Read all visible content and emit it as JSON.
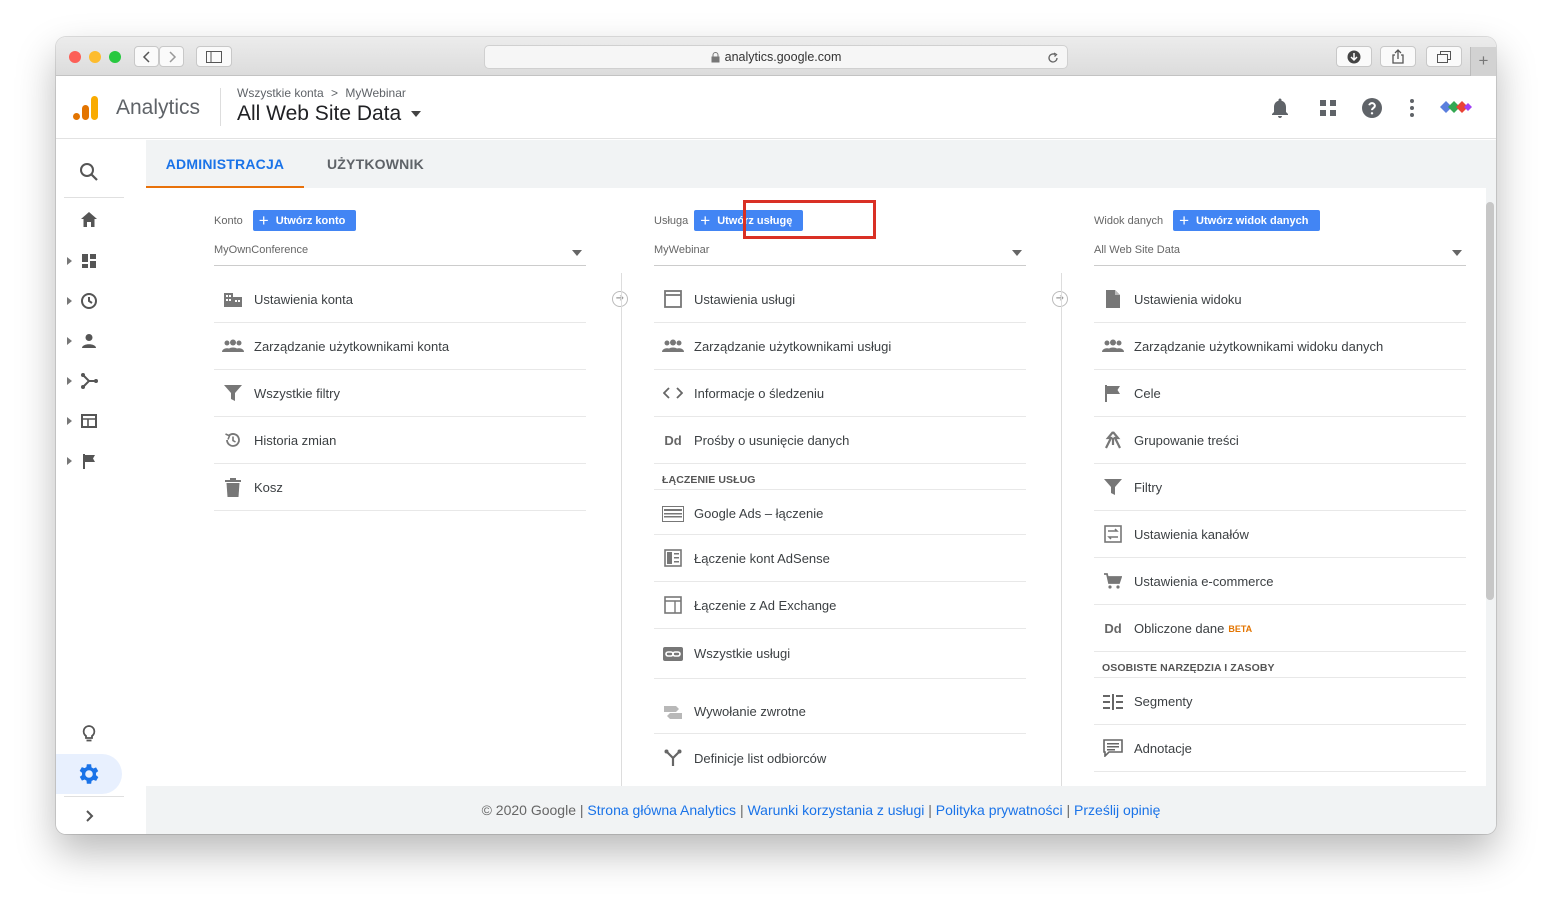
{
  "browser": {
    "url": "analytics.google.com"
  },
  "header": {
    "brand": "Analytics",
    "breadcrumb_account": "Wszystkie konta",
    "breadcrumb_sep": ">",
    "breadcrumb_property": "MyWebinar",
    "view_name": "All Web Site Data"
  },
  "tabs": {
    "admin": "ADMINISTRACJA",
    "user": "UŻYTKOWNIK"
  },
  "account_col": {
    "label": "Konto",
    "create_button": "Utwórz konto",
    "selected": "MyOwnConference",
    "items": [
      {
        "label": "Ustawienia konta",
        "icon": "building-icon"
      },
      {
        "label": "Zarządzanie użytkownikami konta",
        "icon": "people-icon"
      },
      {
        "label": "Wszystkie filtry",
        "icon": "filter-icon"
      },
      {
        "label": "Historia zmian",
        "icon": "history-icon"
      },
      {
        "label": "Kosz",
        "icon": "trash-icon"
      }
    ]
  },
  "property_col": {
    "label": "Usługa",
    "create_button": "Utwórz usługę",
    "selected": "MyWebinar",
    "items": [
      {
        "label": "Ustawienia usługi",
        "icon": "window-icon"
      },
      {
        "label": "Zarządzanie użytkownikami usługi",
        "icon": "people-icon"
      },
      {
        "label": "Informacje o śledzeniu",
        "icon": "code-icon"
      },
      {
        "label": "Prośby o usunięcie danych",
        "icon": "dd-icon"
      }
    ],
    "section_label": "ŁĄCZENIE USŁUG",
    "linking_items": [
      {
        "label": "Google Ads – łączenie",
        "icon": "ads-icon"
      },
      {
        "label": "Łączenie kont AdSense",
        "icon": "adsense-icon"
      },
      {
        "label": "Łączenie z Ad Exchange",
        "icon": "adexchange-icon"
      },
      {
        "label": "Wszystkie usługi",
        "icon": "link-icon"
      },
      {
        "label": "Wywołanie zwrotne",
        "icon": "postback-icon"
      },
      {
        "label": "Definicje list odbiorców",
        "icon": "audience-icon"
      }
    ]
  },
  "view_col": {
    "label": "Widok danych",
    "create_button": "Utwórz widok danych",
    "selected": "All Web Site Data",
    "items": [
      {
        "label": "Ustawienia widoku",
        "icon": "document-icon"
      },
      {
        "label": "Zarządzanie użytkownikami widoku danych",
        "icon": "people-icon"
      },
      {
        "label": "Cele",
        "icon": "flag-icon"
      },
      {
        "label": "Grupowanie treści",
        "icon": "grouping-icon"
      },
      {
        "label": "Filtry",
        "icon": "filter-icon"
      },
      {
        "label": "Ustawienia kanałów",
        "icon": "channel-icon"
      },
      {
        "label": "Ustawienia e-commerce",
        "icon": "cart-icon"
      },
      {
        "label": "Obliczone dane",
        "icon": "dd-icon",
        "badge": "BETA"
      }
    ],
    "section_label": "OSOBISTE NARZĘDZIA I ZASOBY",
    "tools_items": [
      {
        "label": "Segmenty",
        "icon": "segments-icon"
      },
      {
        "label": "Adnotacje",
        "icon": "annotation-icon"
      }
    ]
  },
  "footer": {
    "copyright": "© 2020 Google",
    "sep": "|",
    "link1": "Strona główna Analytics",
    "link2": "Warunki korzystania z usługi",
    "link3": "Polityka prywatności",
    "link4": "Prześlij opinię"
  },
  "colors": {
    "accent": "#4285f4",
    "tab_active": "#1a73e8",
    "tab_underline": "#e8710a",
    "highlight": "#d93025"
  }
}
